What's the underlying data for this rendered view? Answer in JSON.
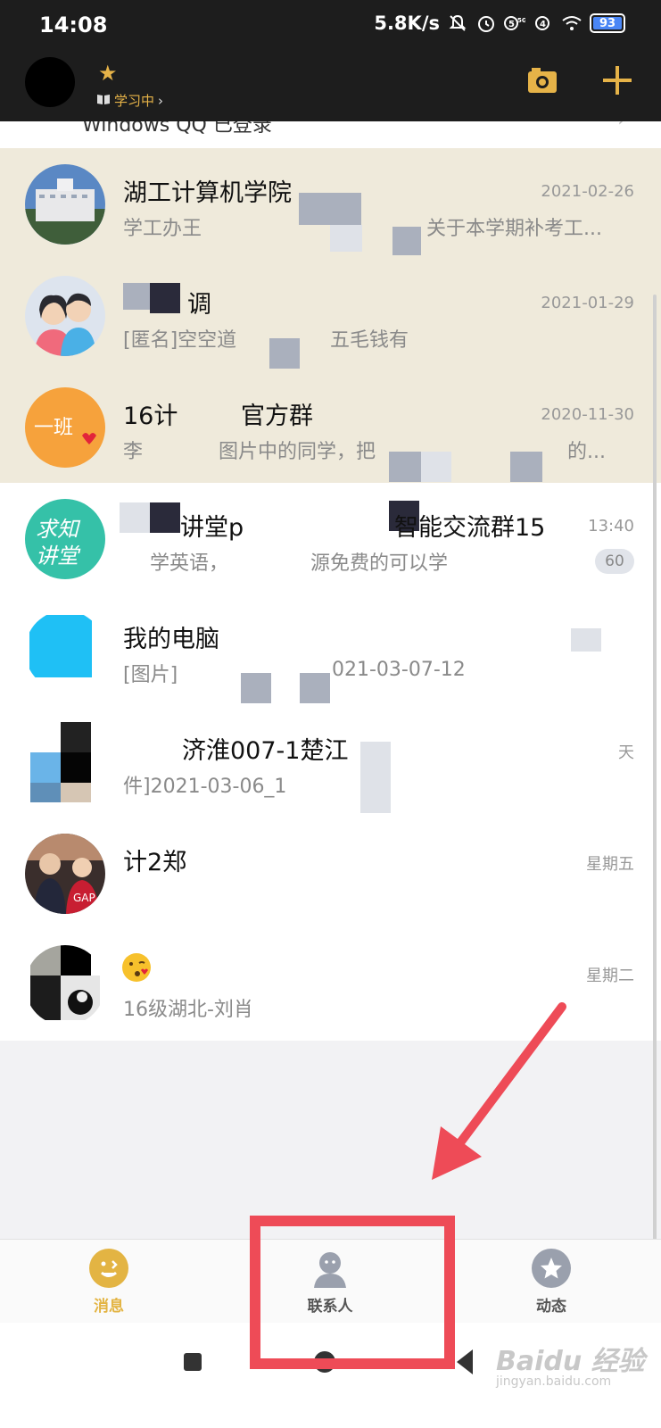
{
  "status_bar": {
    "time": "14:08",
    "network_speed": "5.8K/s",
    "battery": "93",
    "icons": [
      "mute-bell-icon",
      "alarm-icon",
      "5g-signal-icon",
      "4g-signal-icon",
      "wifi-icon",
      "battery-icon"
    ]
  },
  "header": {
    "status_label": "学习中",
    "accent_color": "#e6b348",
    "icons": [
      "camera-icon",
      "plus-icon"
    ]
  },
  "partial_row": {
    "text": "Windows QQ 已登录"
  },
  "chats": [
    {
      "name": "湖工计算机学院",
      "time": "2021-02-26",
      "preview": "学工办王",
      "preview_tail": "关于本学期补考工...",
      "pinned": true
    },
    {
      "name": "调",
      "time": "2021-01-29",
      "preview": "[匿名]空空道",
      "preview_tail": "五毛钱有",
      "pinned": true
    },
    {
      "name": "16计",
      "name_tail": "官方群",
      "time": "2020-11-30",
      "preview": "李",
      "preview_mid": "图片中的同学，把",
      "preview_tail": "的...",
      "pinned": true
    },
    {
      "name": "讲堂p",
      "name_tail": "智能交流群15",
      "time": "13:40",
      "preview": "学英语，",
      "preview_tail": "源免费的可以学",
      "unread": "60",
      "pinned": false
    },
    {
      "name": "我的电脑",
      "time": "",
      "preview": "[图片]",
      "preview_tail": "021-03-07-12",
      "pinned": false
    },
    {
      "name": "济淮007-1楚江",
      "time": "天",
      "preview": "件]2021-03-06_1",
      "pinned": false
    },
    {
      "name": "计2郑",
      "time": "星期五",
      "preview": "",
      "pinned": false
    },
    {
      "name": "",
      "time": "星期二",
      "preview": "16级湖北-刘肖",
      "pinned": false
    }
  ],
  "bottom_nav": {
    "tabs": [
      {
        "label": "消息",
        "active": true
      },
      {
        "label": "联系人",
        "active": false
      },
      {
        "label": "动态",
        "active": false
      }
    ]
  },
  "watermark": {
    "brand": "Baidu 经验",
    "url": "jingyan.baidu.com"
  },
  "annotation": {
    "color": "#ee4b57"
  }
}
